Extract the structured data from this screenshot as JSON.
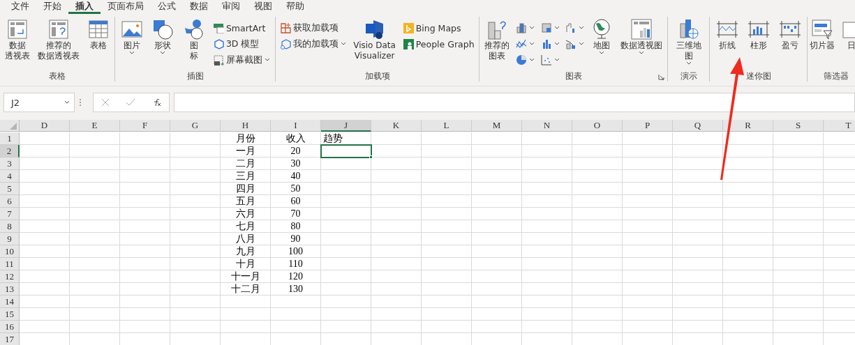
{
  "menu_tabs": [
    {
      "label": "文件",
      "selected": false
    },
    {
      "label": "开始",
      "selected": false
    },
    {
      "label": "插入",
      "selected": true
    },
    {
      "label": "页面布局",
      "selected": false
    },
    {
      "label": "公式",
      "selected": false
    },
    {
      "label": "数据",
      "selected": false
    },
    {
      "label": "审阅",
      "selected": false
    },
    {
      "label": "视图",
      "selected": false
    },
    {
      "label": "帮助",
      "selected": false
    }
  ],
  "ribbon_groups": [
    {
      "label": "表格",
      "items": [
        {
          "kind": "large",
          "label_lines": [
            "数据",
            "透视表"
          ],
          "has_menu": false
        },
        {
          "kind": "large",
          "label_lines": [
            "推荐的",
            "数据透视表"
          ],
          "has_menu": false
        },
        {
          "kind": "large",
          "label_lines": [
            "表格"
          ],
          "has_menu": false
        }
      ]
    },
    {
      "label": "插图",
      "items": [
        {
          "kind": "large",
          "label_lines": [
            "图片"
          ],
          "has_menu": true
        },
        {
          "kind": "large",
          "label_lines": [
            "形状"
          ],
          "has_menu": true
        },
        {
          "kind": "large",
          "label_lines": [
            "图",
            "标"
          ],
          "has_menu": false
        },
        {
          "kind": "stack",
          "items": [
            {
              "kind": "small",
              "label": "SmartArt",
              "has_menu": false
            },
            {
              "kind": "small",
              "label": "3D 模型",
              "has_menu": false
            },
            {
              "kind": "small",
              "label": "屏幕截图",
              "has_menu": true
            }
          ]
        }
      ]
    },
    {
      "label": "加载项",
      "items": [
        {
          "kind": "stack",
          "items": [
            {
              "kind": "small",
              "label": "获取加载项",
              "has_menu": false
            },
            {
              "kind": "small",
              "label": "我的加载项",
              "has_menu": true
            }
          ]
        },
        {
          "kind": "large",
          "label_lines": [
            "Visio Data",
            "Visualizer"
          ],
          "has_menu": false
        },
        {
          "kind": "stack",
          "items": [
            {
              "kind": "small",
              "label": "Bing Maps",
              "has_menu": false
            },
            {
              "kind": "small",
              "label": "People Graph",
              "has_menu": false
            }
          ]
        }
      ]
    },
    {
      "label": "图表",
      "launcher": true,
      "items": [
        {
          "kind": "large",
          "label_lines": [
            "推荐的",
            "图表"
          ],
          "has_menu": false
        },
        {
          "kind": "stack",
          "items": [
            {
              "kind": "icon",
              "has_menu": true
            },
            {
              "kind": "icon",
              "has_menu": true
            },
            {
              "kind": "icon",
              "has_menu": true
            }
          ]
        },
        {
          "kind": "stack",
          "items": [
            {
              "kind": "icon",
              "has_menu": true
            },
            {
              "kind": "icon",
              "has_menu": true
            },
            {
              "kind": "icon",
              "has_menu": true
            }
          ]
        },
        {
          "kind": "stack",
          "items": [
            {
              "kind": "icon",
              "has_menu": true
            },
            {
              "kind": "icon",
              "has_menu": true
            }
          ]
        },
        {
          "kind": "large",
          "label_lines": [
            "地图"
          ],
          "has_menu": true
        },
        {
          "kind": "large",
          "label_lines": [
            "数据透视图"
          ],
          "has_menu": true
        }
      ]
    },
    {
      "label": "演示",
      "items": [
        {
          "kind": "large",
          "label_lines": [
            "三维地",
            "图"
          ],
          "has_menu": true
        }
      ]
    },
    {
      "label": "迷你图",
      "items": [
        {
          "kind": "large",
          "label_lines": [
            "折线"
          ],
          "has_menu": false
        },
        {
          "kind": "large",
          "label_lines": [
            "柱形"
          ],
          "has_menu": false
        },
        {
          "kind": "large",
          "label_lines": [
            "盈亏"
          ],
          "has_menu": false
        }
      ]
    },
    {
      "label": "筛选器",
      "items": [
        {
          "kind": "large",
          "label_lines": [
            "切片器"
          ],
          "has_menu": false
        },
        {
          "kind": "large",
          "label_lines": [
            "日"
          ],
          "has_menu": false
        }
      ]
    }
  ],
  "name_box": "J2",
  "sheet": {
    "columns": [
      {
        "label": "D",
        "selected": false
      },
      {
        "label": "E",
        "selected": false
      },
      {
        "label": "F",
        "selected": false
      },
      {
        "label": "G",
        "selected": false
      },
      {
        "label": "H",
        "selected": false
      },
      {
        "label": "I",
        "selected": false
      },
      {
        "label": "J",
        "selected": true
      },
      {
        "label": "K",
        "selected": false
      },
      {
        "label": "L",
        "selected": false
      },
      {
        "label": "M",
        "selected": false
      },
      {
        "label": "N",
        "selected": false
      },
      {
        "label": "O",
        "selected": false
      },
      {
        "label": "P",
        "selected": false
      },
      {
        "label": "Q",
        "selected": false
      },
      {
        "label": "R",
        "selected": false
      },
      {
        "label": "S",
        "selected": false
      },
      {
        "label": "T",
        "selected": false
      }
    ],
    "rows": [
      {
        "label": "1",
        "selected": false,
        "cells": {
          "H": "月份",
          "I": "收入",
          "J": "趋势"
        }
      },
      {
        "label": "2",
        "selected": true,
        "cells": {
          "H": "一月",
          "I": "20"
        }
      },
      {
        "label": "3",
        "selected": false,
        "cells": {
          "H": "二月",
          "I": "30"
        }
      },
      {
        "label": "4",
        "selected": false,
        "cells": {
          "H": "三月",
          "I": "40"
        }
      },
      {
        "label": "5",
        "selected": false,
        "cells": {
          "H": "四月",
          "I": "50"
        }
      },
      {
        "label": "6",
        "selected": false,
        "cells": {
          "H": "五月",
          "I": "60"
        }
      },
      {
        "label": "7",
        "selected": false,
        "cells": {
          "H": "六月",
          "I": "70"
        }
      },
      {
        "label": "8",
        "selected": false,
        "cells": {
          "H": "七月",
          "I": "80"
        }
      },
      {
        "label": "9",
        "selected": false,
        "cells": {
          "H": "八月",
          "I": "90"
        }
      },
      {
        "label": "10",
        "selected": false,
        "cells": {
          "H": "九月",
          "I": "100"
        }
      },
      {
        "label": "11",
        "selected": false,
        "cells": {
          "H": "十月",
          "I": "110"
        }
      },
      {
        "label": "12",
        "selected": false,
        "cells": {
          "H": "十一月",
          "I": "120"
        }
      },
      {
        "label": "13",
        "selected": false,
        "cells": {
          "H": "十二月",
          "I": "130"
        }
      },
      {
        "label": "14",
        "selected": false,
        "cells": {}
      },
      {
        "label": "15",
        "selected": false,
        "cells": {}
      },
      {
        "label": "16",
        "selected": false,
        "cells": {}
      },
      {
        "label": "17",
        "selected": false,
        "cells": {}
      }
    ]
  },
  "annotation": {
    "kind": "arrow"
  }
}
